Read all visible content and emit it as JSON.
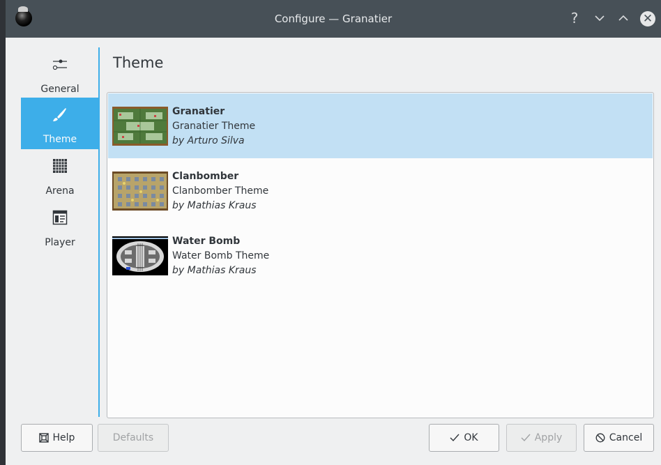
{
  "window": {
    "title": "Configure — Granatier"
  },
  "titlebar": {
    "help_glyph": "?",
    "minimize_glyph": "⌄",
    "maximize_glyph": "⌃",
    "close_glyph": "✕"
  },
  "sidebar": {
    "items": [
      {
        "label": "General",
        "icon": "sliders-icon",
        "active": false
      },
      {
        "label": "Theme",
        "icon": "brush-icon",
        "active": true
      },
      {
        "label": "Arena",
        "icon": "grid-icon",
        "active": false
      },
      {
        "label": "Player",
        "icon": "window-icon",
        "active": false
      }
    ]
  },
  "page": {
    "title": "Theme"
  },
  "themes": [
    {
      "name": "Granatier",
      "description": "Granatier Theme",
      "author": "by Arturo Silva",
      "selected": true
    },
    {
      "name": "Clanbomber",
      "description": "Clanbomber Theme",
      "author": "by Mathias Kraus",
      "selected": false
    },
    {
      "name": "Water Bomb",
      "description": "Water Bomb Theme",
      "author": "by Mathias Kraus",
      "selected": false
    }
  ],
  "buttons": {
    "help": "Help",
    "defaults": "Defaults",
    "ok": "OK",
    "apply": "Apply",
    "cancel": "Cancel"
  },
  "colors": {
    "accent": "#3daee9",
    "selection": "#c2e0f4",
    "titlebar": "#475057"
  }
}
